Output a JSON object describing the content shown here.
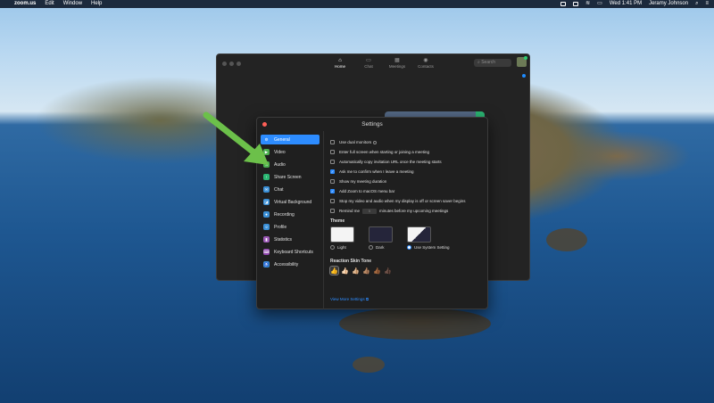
{
  "menubar": {
    "app_name": "zoom.us",
    "menus": [
      "Edit",
      "Window",
      "Help"
    ],
    "clock": "Wed 1:41 PM",
    "user": "Jeramy Johnson"
  },
  "zoom_window": {
    "nav": [
      {
        "label": "Home",
        "icon": "home-icon",
        "glyph": "⌂",
        "active": true
      },
      {
        "label": "Chat",
        "icon": "chat-icon",
        "glyph": "▭",
        "active": false
      },
      {
        "label": "Meetings",
        "icon": "calendar-icon",
        "glyph": "▦",
        "active": false
      },
      {
        "label": "Contacts",
        "icon": "contacts-icon",
        "glyph": "◉",
        "active": false
      }
    ],
    "search_placeholder": "Search"
  },
  "settings": {
    "title": "Settings",
    "sidebar": [
      {
        "label": "General",
        "icon": "gear-icon",
        "glyph": "⚙",
        "color": "#2d8cff",
        "active": true
      },
      {
        "label": "Video",
        "icon": "video-icon",
        "glyph": "▶",
        "color": "#4caf50",
        "active": false
      },
      {
        "label": "Audio",
        "icon": "headphones-icon",
        "glyph": "♫",
        "color": "#4caf50",
        "active": false
      },
      {
        "label": "Share Screen",
        "icon": "share-screen-icon",
        "glyph": "↑",
        "color": "#2bb673",
        "active": false
      },
      {
        "label": "Chat",
        "icon": "chat-icon",
        "glyph": "✉",
        "color": "#3a8fd6",
        "active": false
      },
      {
        "label": "Virtual Background",
        "icon": "virtual-background-icon",
        "glyph": "◪",
        "color": "#3a8fd6",
        "active": false
      },
      {
        "label": "Recording",
        "icon": "recording-icon",
        "glyph": "●",
        "color": "#3a8fd6",
        "active": false
      },
      {
        "label": "Profile",
        "icon": "profile-icon",
        "glyph": "☺",
        "color": "#3a8fd6",
        "active": false
      },
      {
        "label": "Statistics",
        "icon": "statistics-icon",
        "glyph": "▮",
        "color": "#9b59b6",
        "active": false
      },
      {
        "label": "Keyboard Shortcuts",
        "icon": "keyboard-icon",
        "glyph": "⌨",
        "color": "#8e44ad",
        "active": false
      },
      {
        "label": "Accessibility",
        "icon": "accessibility-icon",
        "glyph": "♿",
        "color": "#3a8fd6",
        "active": false
      }
    ],
    "options": [
      {
        "label": "Use dual monitors",
        "checked": false,
        "info": true
      },
      {
        "label": "Enter full screen when starting or joining a meeting",
        "checked": false,
        "info": false
      },
      {
        "label": "Automatically copy invitation URL once the meeting starts",
        "checked": false,
        "info": false
      },
      {
        "label": "Ask me to confirm when I leave a meeting",
        "checked": true,
        "info": false
      },
      {
        "label": "Show my meeting duration",
        "checked": false,
        "info": false
      },
      {
        "label": "Add Zoom to macOS menu bar",
        "checked": true,
        "info": false
      },
      {
        "label": "Stop my video and audio when my display is off or screen saver begins",
        "checked": false,
        "info": false
      }
    ],
    "remind": {
      "before": "Remind me",
      "value": "5",
      "after": "minutes before my upcoming meetings",
      "checked": false
    },
    "theme": {
      "heading": "Theme",
      "options": [
        {
          "label": "Light",
          "selected": false
        },
        {
          "label": "Dark",
          "selected": false
        },
        {
          "label": "Use System Setting",
          "selected": true
        }
      ]
    },
    "skin_tone": {
      "heading": "Reaction Skin Tone",
      "tones": [
        "👍",
        "👍🏻",
        "👍🏼",
        "👍🏽",
        "👍🏾",
        "👍🏿"
      ],
      "selected_index": 0
    },
    "view_more": "View More Settings ⧉"
  },
  "colors": {
    "accent": "#2d8cff",
    "arrow": "#6cc04a"
  }
}
